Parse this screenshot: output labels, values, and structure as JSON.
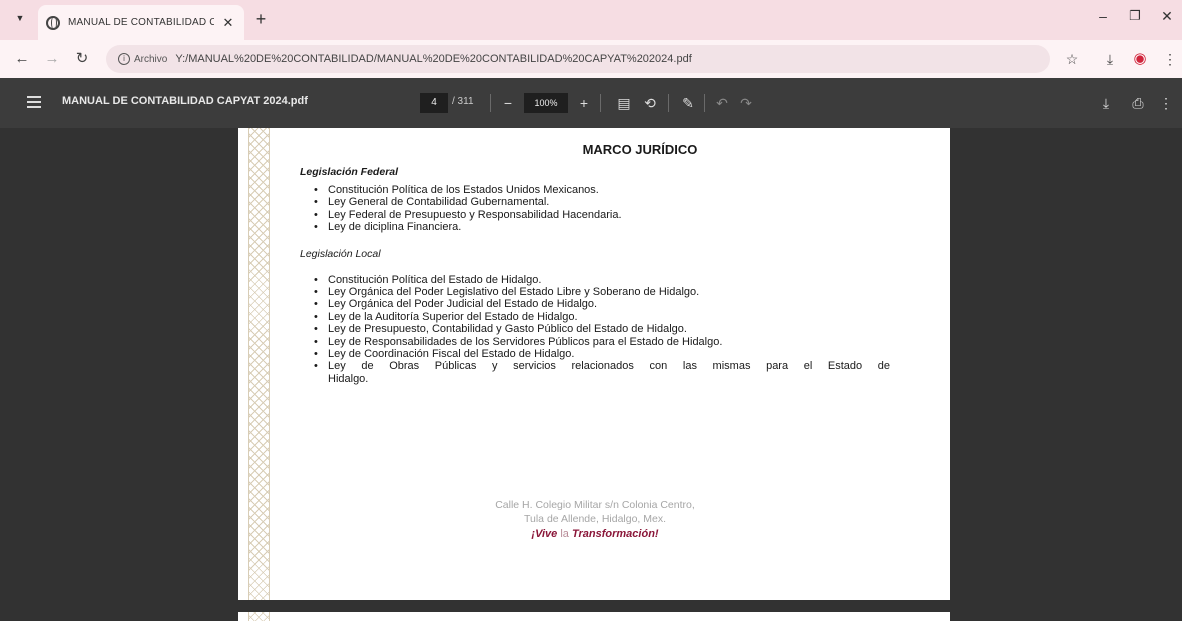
{
  "browser": {
    "tab_title": "MANUAL DE CONTABILIDAD C",
    "url_chip": "Archivo",
    "url": "Y:/MANUAL%20DE%20CONTABILIDAD/MANUAL%20DE%20CONTABILIDAD%20CAPYAT%202024.pdf"
  },
  "viewer": {
    "file_name": "MANUAL DE CONTABILIDAD CAPYAT 2024.pdf",
    "page_current": "4",
    "page_total": "/ 311",
    "zoom": "100%"
  },
  "document": {
    "title": "MARCO JURÍDICO",
    "federal_heading": "Legislación Federal",
    "federal_items": [
      "Constitución Política de los Estados Unidos Mexicanos.",
      "Ley General de Contabilidad Gubernamental.",
      "Ley Federal de Presupuesto y Responsabilidad Hacendaria.",
      "Ley de diciplina Financiera."
    ],
    "local_heading": "Legislación Local",
    "local_items": [
      "Constitución Política del Estado de Hidalgo.",
      "Ley Orgánica del Poder Legislativo del Estado Libre y Soberano de Hidalgo.",
      "Ley Orgánica del Poder Judicial del Estado de Hidalgo.",
      "Ley de la Auditoría Superior del Estado de Hidalgo.",
      "Ley de Presupuesto, Contabilidad y Gasto Público del Estado de Hidalgo.",
      "Ley de Responsabilidades de los Servidores Públicos para el Estado de Hidalgo.",
      "Ley de Coordinación Fiscal del Estado de Hidalgo."
    ],
    "local_last_item_line1": "Ley de Obras Públicas y servicios relacionados con las mismas para el Estado de",
    "local_last_item_line2": "Hidalgo.",
    "footer_address_1": "Calle H. Colegio Militar s/n Colonia Centro,",
    "footer_address_2": "Tula de Allende, Hidalgo, Mex.",
    "slogan_vive": "¡Vive",
    "slogan_la": "la",
    "slogan_transformacion": "Transformación!"
  },
  "colors": {
    "tab_strip": "#f6dde3",
    "toolbar": "#3c3c3c",
    "viewer_bg": "#323232",
    "slogan": "#8a1538"
  }
}
